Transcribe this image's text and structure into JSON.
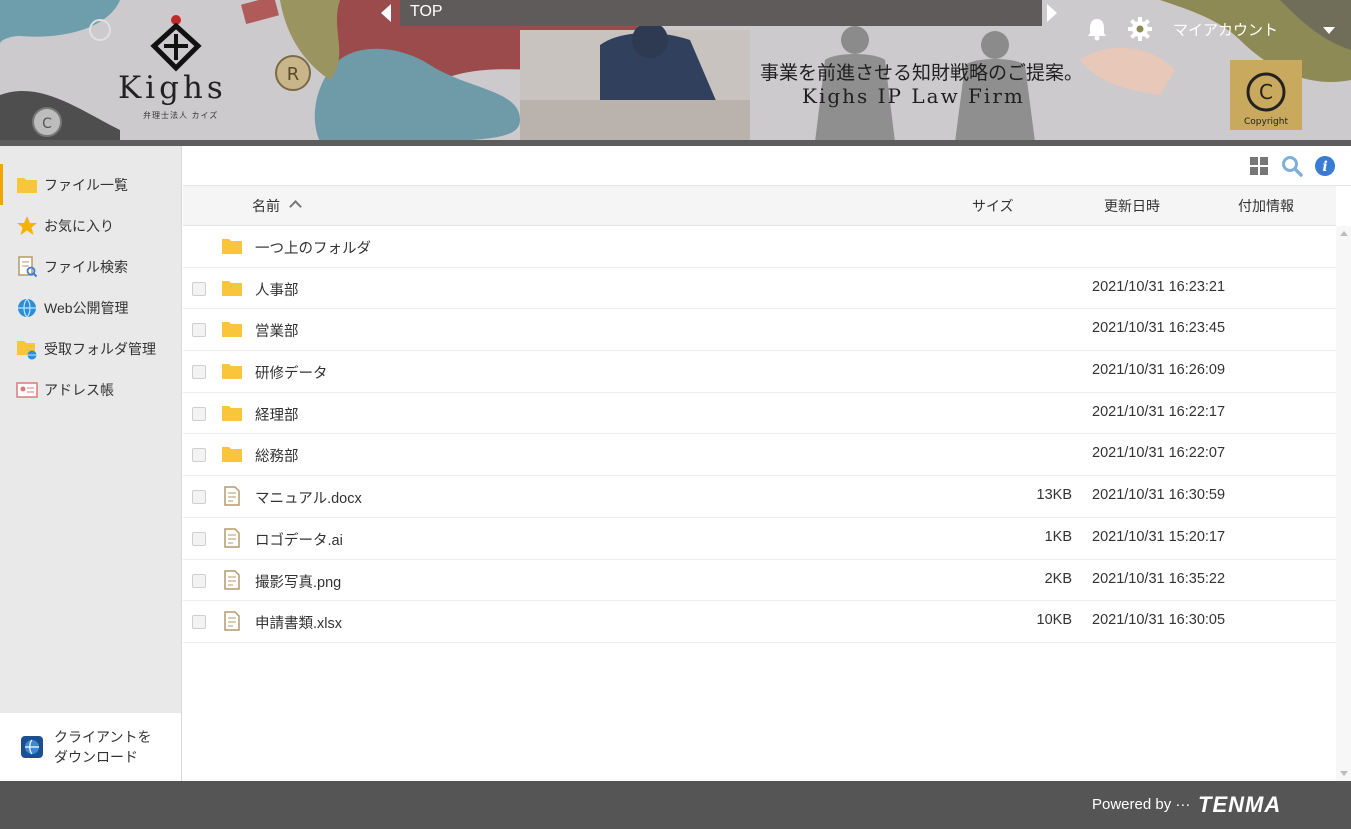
{
  "banner": {
    "logo": "Kighs",
    "logo_sub": "弁理士法人 カイズ",
    "tagline": "事業を前進させる知財戦略のご提案。",
    "firm": "Kighs IP Law Firm",
    "copyright_badge": "Copyright"
  },
  "header": {
    "breadcrumb": "TOP",
    "account": "マイアカウント"
  },
  "sidebar": {
    "items": [
      {
        "label": "ファイル一覧",
        "icon": "folder-icon"
      },
      {
        "label": "お気に入り",
        "icon": "star-icon"
      },
      {
        "label": "ファイル検索",
        "icon": "file-search-icon"
      },
      {
        "label": "Web公開管理",
        "icon": "globe-icon"
      },
      {
        "label": "受取フォルダ管理",
        "icon": "inbox-folder-icon"
      },
      {
        "label": "アドレス帳",
        "icon": "address-book-icon"
      }
    ],
    "client_download": {
      "line1": "クライアントを",
      "line2": "ダウンロード"
    }
  },
  "table": {
    "headers": {
      "name": "名前",
      "size": "サイズ",
      "modified": "更新日時",
      "info": "付加情報"
    },
    "parent": "一つ上のフォルダ",
    "rows": [
      {
        "name": "人事部",
        "type": "folder",
        "size": "",
        "date": "2021/10/31 16:23:21"
      },
      {
        "name": "営業部",
        "type": "folder",
        "size": "",
        "date": "2021/10/31 16:23:45"
      },
      {
        "name": "研修データ",
        "type": "folder",
        "size": "",
        "date": "2021/10/31 16:26:09"
      },
      {
        "name": "経理部",
        "type": "folder",
        "size": "",
        "date": "2021/10/31 16:22:17"
      },
      {
        "name": "総務部",
        "type": "folder",
        "size": "",
        "date": "2021/10/31 16:22:07"
      },
      {
        "name": "マニュアル.docx",
        "type": "file",
        "size": "13KB",
        "date": "2021/10/31 16:30:59"
      },
      {
        "name": "ロゴデータ.ai",
        "type": "file",
        "size": "1KB",
        "date": "2021/10/31 15:20:17"
      },
      {
        "name": "撮影写真.png",
        "type": "file",
        "size": "2KB",
        "date": "2021/10/31 16:35:22"
      },
      {
        "name": "申請書類.xlsx",
        "type": "file",
        "size": "10KB",
        "date": "2021/10/31 16:30:05"
      }
    ]
  },
  "footer": {
    "powered": "Powered by ···",
    "brand": "TENMA"
  },
  "colors": {
    "accent": "#f0a500",
    "folder": "#f9c53b",
    "footer": "#555555",
    "info": "#3a7bd5"
  }
}
